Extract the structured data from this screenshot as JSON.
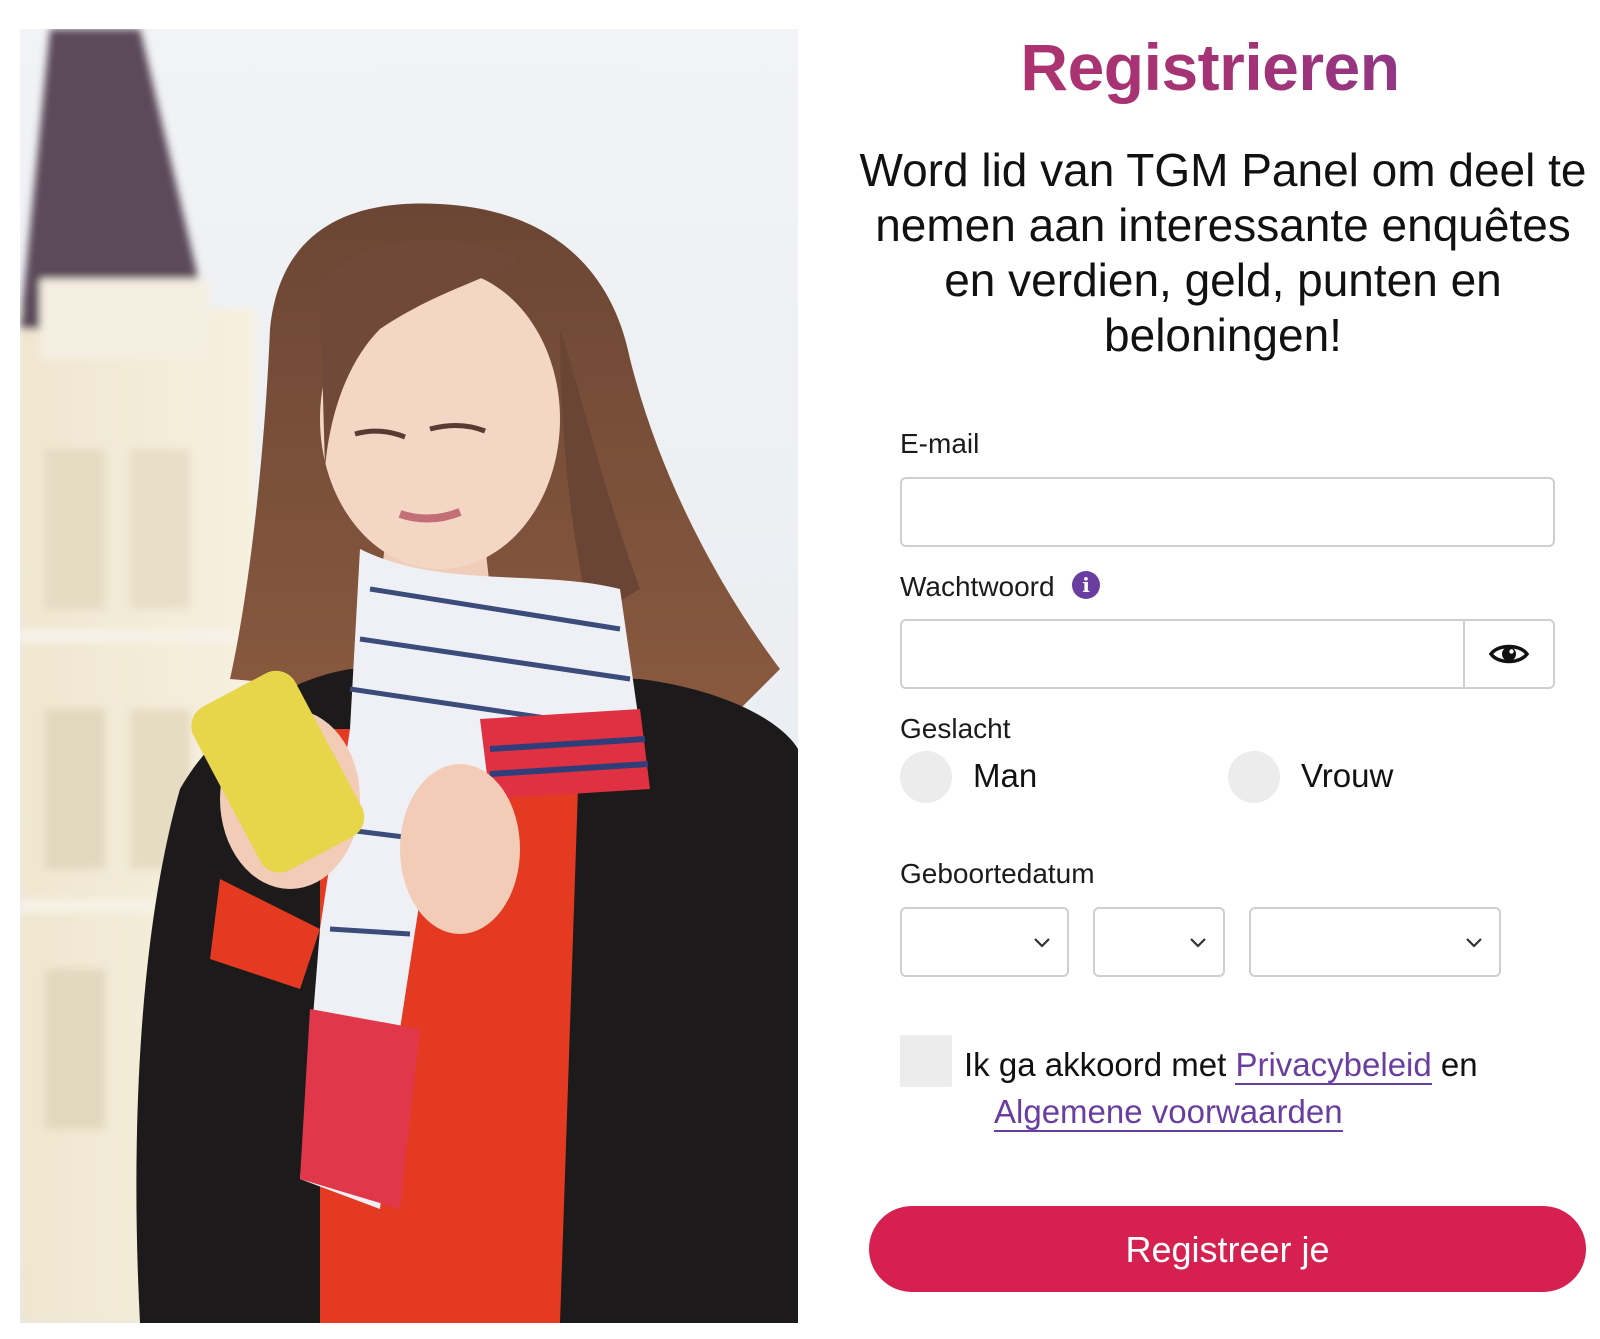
{
  "page": {
    "title": "Registrieren",
    "subtitle": "Word lid van TGM Panel om deel te nemen aan interessante enquêtes en verdien, geld, punten en beloningen!"
  },
  "form": {
    "email_label": "E-mail",
    "email_value": "",
    "password_label": "Wachtwoord",
    "password_value": "",
    "gender_label": "Geslacht",
    "gender_options": [
      "Man",
      "Vrouw"
    ],
    "birthdate_label": "Geboortedatum",
    "birthdate_day": "",
    "birthdate_month": "",
    "birthdate_year": "",
    "agree_prefix": "Ik ga akkoord met",
    "privacy_link": "Privacybeleid",
    "agree_conjunction": "en",
    "terms_link": "Algemene voorwaarden",
    "submit_label": "Registreer je"
  },
  "icons": {
    "password_info": "info-icon",
    "password_toggle": "eye-icon",
    "select_arrow": "chevron-down-icon"
  },
  "colors": {
    "title_gradient_start": "#b4336a",
    "title_gradient_end": "#7a3a95",
    "accent_purple": "#6a3ea0",
    "submit_button": "#d6204f",
    "control_fill": "#ececec",
    "border": "#cfcfcf"
  }
}
